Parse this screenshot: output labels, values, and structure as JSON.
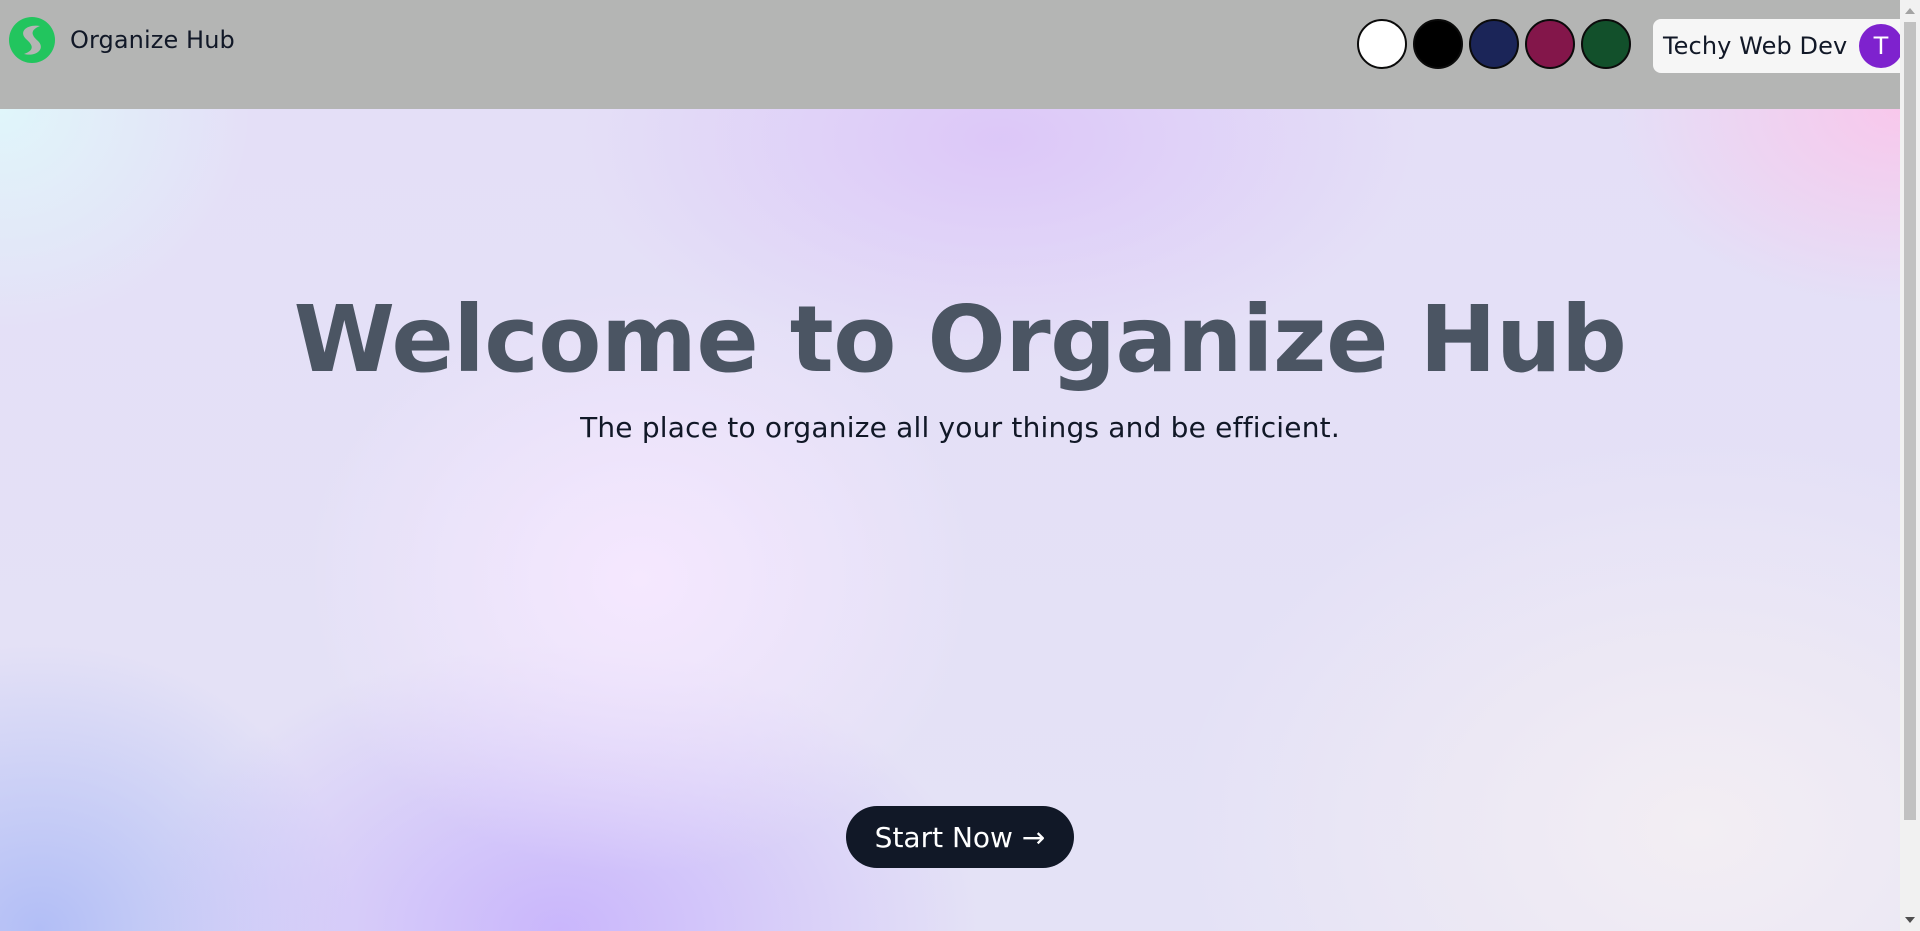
{
  "navbar": {
    "brand_name": "Organize Hub",
    "brand_logo_color": "#22c55e",
    "theme_swatches": [
      {
        "name": "white",
        "color": "#ffffff"
      },
      {
        "name": "black",
        "color": "#000000"
      },
      {
        "name": "navy",
        "color": "#1b2558"
      },
      {
        "name": "crimson",
        "color": "#83164a"
      },
      {
        "name": "forest-green",
        "color": "#12502b"
      }
    ],
    "user": {
      "name": "Techy Web Dev",
      "avatar_initial": "T",
      "avatar_color": "#7e22ce"
    }
  },
  "hero": {
    "title": "Welcome to Organize Hub",
    "subtitle": "The place to organize all your things and be efficient.",
    "cta_label": "Start Now →"
  }
}
